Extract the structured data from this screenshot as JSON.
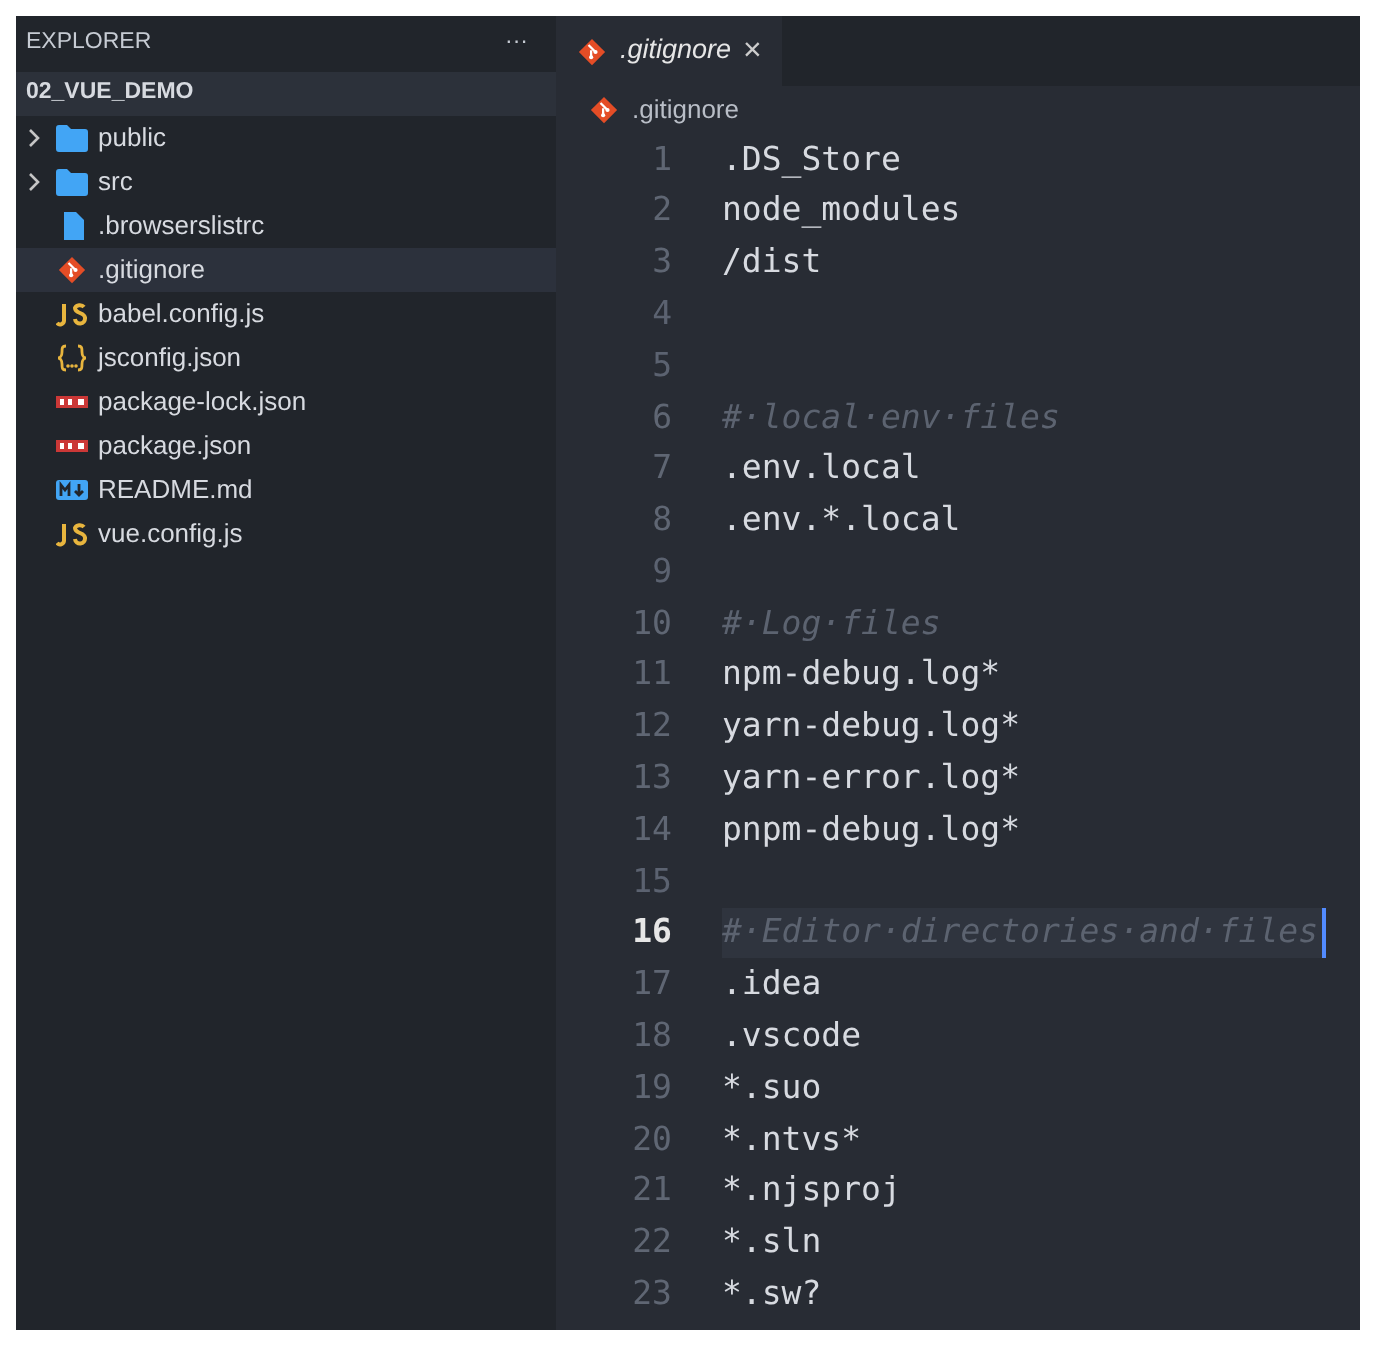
{
  "sidebar": {
    "title": "EXPLORER",
    "more": "···",
    "folder": "02_VUE_DEMO",
    "items": [
      {
        "name": "public",
        "kind": "folder",
        "expanded": false,
        "selected": false
      },
      {
        "name": "src",
        "kind": "folder",
        "expanded": false,
        "selected": false
      },
      {
        "name": ".browserslistrc",
        "kind": "file",
        "selected": false
      },
      {
        "name": ".gitignore",
        "kind": "git",
        "selected": true
      },
      {
        "name": "babel.config.js",
        "kind": "js",
        "selected": false
      },
      {
        "name": "jsconfig.json",
        "kind": "json",
        "selected": false
      },
      {
        "name": "package-lock.json",
        "kind": "npm",
        "selected": false
      },
      {
        "name": "package.json",
        "kind": "npm",
        "selected": false
      },
      {
        "name": "README.md",
        "kind": "markdown",
        "selected": false
      },
      {
        "name": "vue.config.js",
        "kind": "js",
        "selected": false
      }
    ]
  },
  "tabs": [
    {
      "label": ".gitignore",
      "selected": true,
      "close": "×"
    }
  ],
  "breadcrumb": ".gitignore",
  "editor": {
    "lines": [
      {
        "number": "1",
        "text": ".DS_Store",
        "kind": "code",
        "current": false
      },
      {
        "number": "2",
        "text": "node_modules",
        "kind": "code",
        "current": false
      },
      {
        "number": "3",
        "text": "/dist",
        "kind": "code",
        "current": false
      },
      {
        "number": "4",
        "kind": "blank",
        "current": false
      },
      {
        "number": "5",
        "kind": "blank",
        "current": false
      },
      {
        "number": "6",
        "text": "#·local·env·files",
        "kind": "comment",
        "current": false
      },
      {
        "number": "7",
        "text": ".env.local",
        "kind": "code",
        "current": false
      },
      {
        "number": "8",
        "text": ".env.*.local",
        "kind": "code",
        "current": false
      },
      {
        "number": "9",
        "kind": "blank",
        "current": false
      },
      {
        "number": "10",
        "text": "#·Log·files",
        "kind": "comment",
        "current": false
      },
      {
        "number": "11",
        "text": "npm-debug.log*",
        "kind": "code",
        "current": false
      },
      {
        "number": "12",
        "text": "yarn-debug.log*",
        "kind": "code",
        "current": false
      },
      {
        "number": "13",
        "text": "yarn-error.log*",
        "kind": "code",
        "current": false
      },
      {
        "number": "14",
        "text": "pnpm-debug.log*",
        "kind": "code",
        "current": false
      },
      {
        "number": "15",
        "kind": "blank",
        "current": false
      },
      {
        "number": "16",
        "text": "#·Editor·directories·and·files",
        "kind": "comment",
        "current": true
      },
      {
        "number": "17",
        "text": ".idea",
        "kind": "code",
        "current": false
      },
      {
        "number": "18",
        "text": ".vscode",
        "kind": "code",
        "current": false
      },
      {
        "number": "19",
        "text": "*.suo",
        "kind": "code",
        "current": false
      },
      {
        "number": "20",
        "text": "*.ntvs*",
        "kind": "code",
        "current": false
      },
      {
        "number": "21",
        "text": "*.njsproj",
        "kind": "code",
        "current": false
      },
      {
        "number": "22",
        "text": "*.sln",
        "kind": "code",
        "current": false
      },
      {
        "number": "23",
        "text": "*.sw?",
        "kind": "code",
        "current": false
      }
    ]
  }
}
